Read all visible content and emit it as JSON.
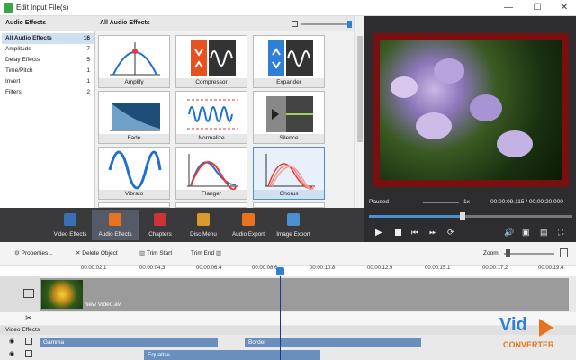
{
  "window": {
    "title": "Edit Input File(s)",
    "min": "—",
    "max": "☐",
    "close": "✕"
  },
  "categories": {
    "header": "Audio Effects",
    "items": [
      {
        "label": "All Audio Effects",
        "count": "16"
      },
      {
        "label": "Amplitude",
        "count": "7"
      },
      {
        "label": "Delay Effects",
        "count": "5"
      },
      {
        "label": "Time/Pitch",
        "count": "1"
      },
      {
        "label": "Invert",
        "count": "1"
      },
      {
        "label": "Filters",
        "count": "2"
      }
    ]
  },
  "effects": {
    "header": "All Audio Effects",
    "tiles": [
      "Amplify",
      "Compressor",
      "Expander",
      "Fade",
      "Normalize",
      "Silence",
      "Vibrato",
      "Flanger",
      "Chorus"
    ]
  },
  "preview": {
    "status": "Paused",
    "speed": "1x",
    "time": "00:00:09.115 / 00:00:20.000"
  },
  "toolbar": {
    "items": [
      "Video Effects",
      "Audio Effects",
      "Chapters",
      "Disc Menu",
      "Audio Export",
      "Image Export"
    ]
  },
  "edit": {
    "properties": "Properties...",
    "delete": "Delete Object",
    "trim_start": "Trim Start",
    "trim_end": "Trim End",
    "zoom": "Zoom:"
  },
  "ruler": [
    "00:00:02.1",
    "00:00:04.3",
    "00:00:06.4",
    "00:00:08.6",
    "00:00:10.8",
    "00:00:12.9",
    "00:00:15.1",
    "00:00:17.2",
    "00:00:19.4"
  ],
  "timeline": {
    "clip": "New Video.avi",
    "section": "Video Effects",
    "fx1": "Gamma",
    "fx2": "Border",
    "fx3": "Equalize"
  },
  "logo": {
    "line1": "Vid",
    "line2": "CONVERTER"
  },
  "colors": {
    "accent": "#2f7fd6",
    "logo_orange": "#e8731e"
  }
}
